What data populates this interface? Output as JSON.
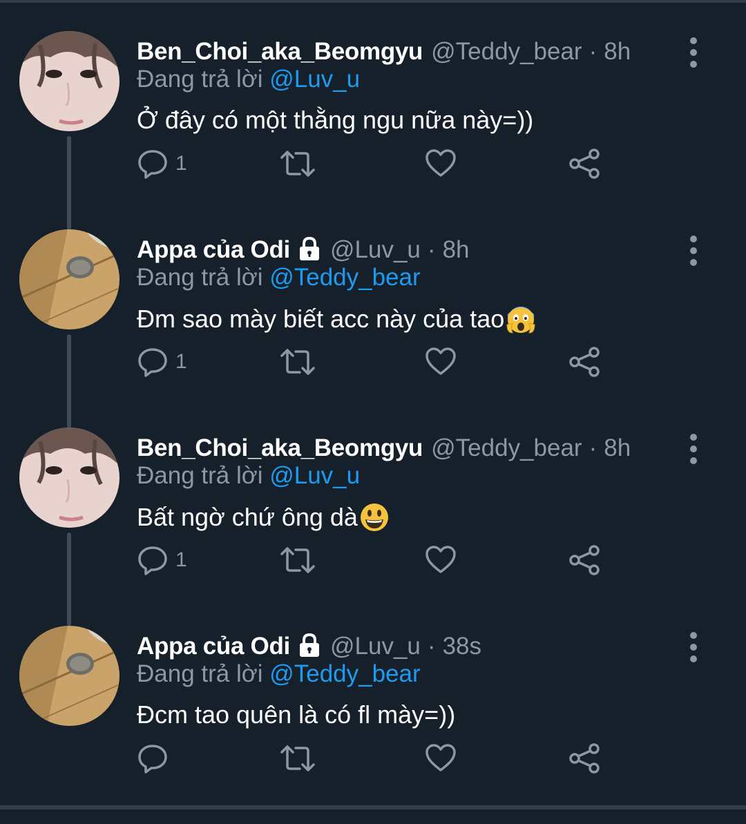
{
  "tweets": [
    {
      "name": "Ben_Choi_aka_Beomgyu",
      "handle": "@Teddy_bear",
      "time": "8h",
      "reply_prefix": "Đang trả lời",
      "reply_to": "@Luv_u",
      "text": "Ở đây có một thằng ngu nữa này=))",
      "reply_count": "1",
      "locked": false,
      "emoji": ""
    },
    {
      "name": "Appa của Odi",
      "handle": "@Luv_u",
      "time": "8h",
      "reply_prefix": "Đang trả lời",
      "reply_to": "@Teddy_bear",
      "text": "Đm sao mày biết acc này của tao",
      "reply_count": "1",
      "locked": true,
      "emoji": "face-screaming-in-fear"
    },
    {
      "name": "Ben_Choi_aka_Beomgyu",
      "handle": "@Teddy_bear",
      "time": "8h",
      "reply_prefix": "Đang trả lời",
      "reply_to": "@Luv_u",
      "text": "Bất ngờ chứ ông dà",
      "reply_count": "1",
      "locked": false,
      "emoji": "grinning-face"
    },
    {
      "name": "Appa của Odi",
      "handle": "@Luv_u",
      "time": "38s",
      "reply_prefix": "Đang trả lời",
      "reply_to": "@Teddy_bear",
      "text": "Đcm tao quên là có fl mày=))",
      "reply_count": "",
      "locked": true,
      "emoji": ""
    }
  ],
  "separator": "·",
  "colors": {
    "background": "#15202b",
    "text": "#ffffff",
    "secondary": "#8b98a5",
    "link": "#1d9bf0",
    "thread_line": "#3d4a57"
  },
  "icons": [
    "reply-icon",
    "retweet-icon",
    "like-icon",
    "share-icon",
    "more-icon",
    "lock-icon"
  ]
}
